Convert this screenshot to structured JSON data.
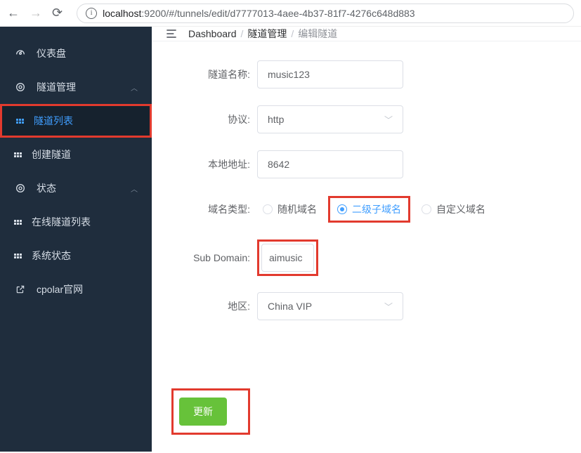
{
  "browser": {
    "url_host": "localhost",
    "url_port": ":9200",
    "url_path": "/#/tunnels/edit/d7777013-4aee-4b37-81f7-4276c648d883"
  },
  "sidebar": {
    "dashboard": "仪表盘",
    "tunnels": "隧道管理",
    "tunnel_list": "隧道列表",
    "tunnel_create": "创建隧道",
    "status": "状态",
    "online_list": "在线隧道列表",
    "system_status": "系统状态",
    "cpolar_site": "cpolar官网"
  },
  "breadcrumbs": {
    "dashboard": "Dashboard",
    "tunnels": "隧道管理",
    "edit": "编辑隧道"
  },
  "form": {
    "labels": {
      "name": "隧道名称:",
      "protocol": "协议:",
      "local_addr": "本地地址:",
      "domain_type": "域名类型:",
      "sub_domain": "Sub Domain:",
      "region": "地区:"
    },
    "values": {
      "name": "music123",
      "protocol": "http",
      "local_addr": "8642",
      "sub_domain": "aimusic",
      "region": "China VIP"
    },
    "domain_options": {
      "random": "随机域名",
      "subdomain": "二级子域名",
      "custom": "自定义域名"
    }
  },
  "actions": {
    "submit": "更新"
  }
}
